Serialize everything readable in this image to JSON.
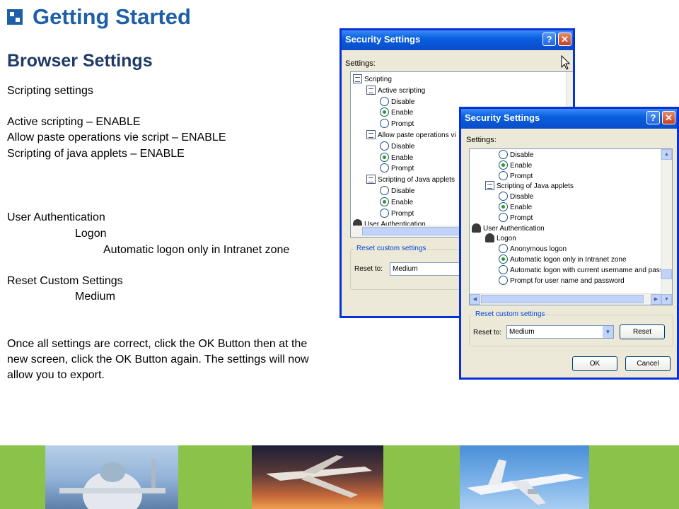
{
  "slide": {
    "title": "Getting Started",
    "section_title": "Browser Settings",
    "scripting_heading": "Scripting settings",
    "setting_lines": [
      "Active scripting – ENABLE",
      "Allow paste operations vie script – ENABLE",
      "Scripting of java applets – ENABLE"
    ],
    "user_auth": "User Authentication",
    "logon": "Logon",
    "auto_logon": "Automatic logon only in Intranet zone",
    "reset_custom": "Reset Custom Settings",
    "medium": "Medium",
    "instructions": "Once all settings are correct, click the OK Button then at the new screen, click the OK Button again.  The settings will now allow you to export."
  },
  "dialog1": {
    "title": "Security Settings",
    "help_glyph": "?",
    "close_glyph": "✕",
    "settings_label": "Settings:",
    "tree": [
      {
        "label": "Scripting",
        "icon": "page-icon",
        "indent": 0
      },
      {
        "label": "Active scripting",
        "icon": "page-icon",
        "indent": 1
      },
      {
        "label": "Disable",
        "icon": "radio-icon",
        "indent": 2,
        "checked": false
      },
      {
        "label": "Enable",
        "icon": "radio-icon",
        "indent": 2,
        "checked": true
      },
      {
        "label": "Prompt",
        "icon": "radio-icon",
        "indent": 2,
        "checked": false
      },
      {
        "label": "Allow paste operations vi",
        "icon": "page-icon",
        "indent": 1
      },
      {
        "label": "Disable",
        "icon": "radio-icon",
        "indent": 2,
        "checked": false
      },
      {
        "label": "Enable",
        "icon": "radio-icon",
        "indent": 2,
        "checked": true
      },
      {
        "label": "Prompt",
        "icon": "radio-icon",
        "indent": 2,
        "checked": false
      },
      {
        "label": "Scripting of Java applets",
        "icon": "page-icon",
        "indent": 1
      },
      {
        "label": "Disable",
        "icon": "radio-icon",
        "indent": 2,
        "checked": false
      },
      {
        "label": "Enable",
        "icon": "radio-icon",
        "indent": 2,
        "checked": true
      },
      {
        "label": "Prompt",
        "icon": "radio-icon",
        "indent": 2,
        "checked": false
      },
      {
        "label": "User Authentication",
        "icon": "user-icon",
        "indent": 0
      }
    ],
    "group_title": "Reset custom settings",
    "reset_to_label": "Reset to:",
    "reset_value": "Medium"
  },
  "dialog2": {
    "title": "Security Settings",
    "help_glyph": "?",
    "close_glyph": "✕",
    "settings_label": "Settings:",
    "tree": [
      {
        "label": "Disable",
        "icon": "radio-icon",
        "indent": 2,
        "checked": false
      },
      {
        "label": "Enable",
        "icon": "radio-icon",
        "indent": 2,
        "checked": true
      },
      {
        "label": "Prompt",
        "icon": "radio-icon",
        "indent": 2,
        "checked": false
      },
      {
        "label": "Scripting of Java applets",
        "icon": "page-icon",
        "indent": 1
      },
      {
        "label": "Disable",
        "icon": "radio-icon",
        "indent": 2,
        "checked": false
      },
      {
        "label": "Enable",
        "icon": "radio-icon",
        "indent": 2,
        "checked": true
      },
      {
        "label": "Prompt",
        "icon": "radio-icon",
        "indent": 2,
        "checked": false
      },
      {
        "label": "User Authentication",
        "icon": "user-icon",
        "indent": 0
      },
      {
        "label": "Logon",
        "icon": "user-icon",
        "indent": 1
      },
      {
        "label": "Anonymous logon",
        "icon": "radio-icon",
        "indent": 2,
        "checked": false
      },
      {
        "label": "Automatic logon only in Intranet zone",
        "icon": "radio-icon",
        "indent": 2,
        "checked": true
      },
      {
        "label": "Automatic logon with current username and passwo",
        "icon": "radio-icon",
        "indent": 2,
        "checked": false
      },
      {
        "label": "Prompt for user name and password",
        "icon": "radio-icon",
        "indent": 2,
        "checked": false
      }
    ],
    "group_title": "Reset custom settings",
    "reset_to_label": "Reset to:",
    "reset_value": "Medium",
    "reset_button": "Reset",
    "ok_button": "OK",
    "cancel_button": "Cancel"
  },
  "scroll_glyphs": {
    "up": "▲",
    "down": "▼",
    "left": "◀",
    "right": "▶",
    "dropdown": "▼"
  },
  "colors": {
    "title_blue": "#1f5fa8",
    "xp_titlebar": "#0a5fe0",
    "dialog_face": "#ece9d8",
    "footer_green": "#8bc34a",
    "radio_checked": "#21a121"
  }
}
